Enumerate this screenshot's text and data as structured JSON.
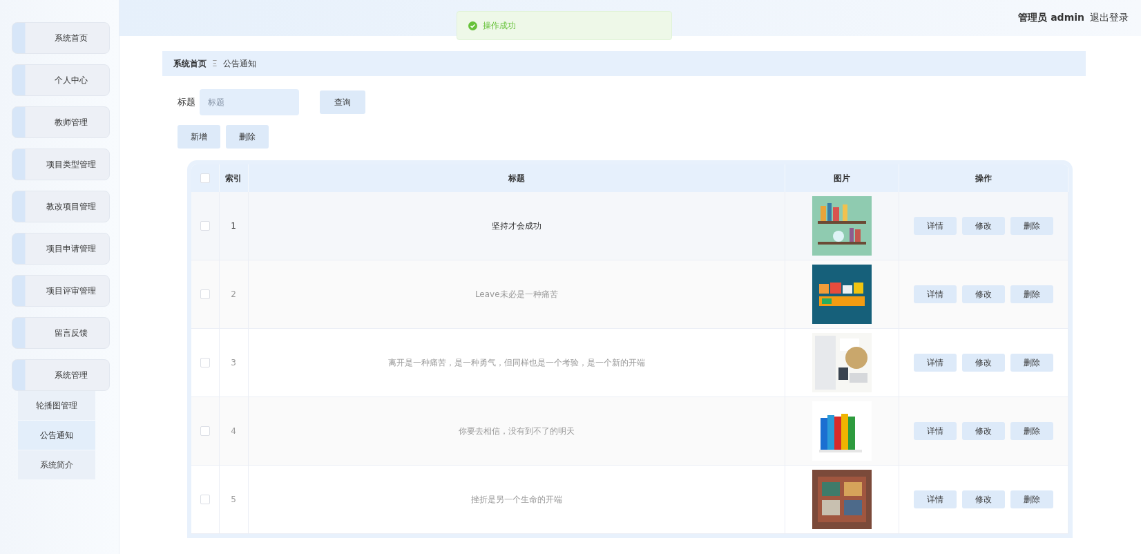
{
  "sidebar": {
    "items": [
      {
        "label": "系统首页",
        "expanded": false
      },
      {
        "label": "个人中心",
        "expanded": false
      },
      {
        "label": "教师管理",
        "expanded": false
      },
      {
        "label": "项目类型管理",
        "expanded": false
      },
      {
        "label": "教改项目管理",
        "expanded": false
      },
      {
        "label": "项目申请管理",
        "expanded": false
      },
      {
        "label": "项目评审管理",
        "expanded": false
      },
      {
        "label": "留言反馈",
        "expanded": false
      },
      {
        "label": "系统管理",
        "expanded": true,
        "children": [
          {
            "label": "轮播图管理",
            "selected": false
          },
          {
            "label": "公告通知",
            "selected": true
          },
          {
            "label": "系统简介",
            "selected": false
          }
        ]
      }
    ]
  },
  "toast": {
    "message": "操作成功"
  },
  "header": {
    "role": "管理员 admin",
    "logout": "退出登录"
  },
  "breadcrumb": {
    "home": "系统首页",
    "separator": "Ξ",
    "current": "公告通知"
  },
  "search": {
    "label": "标题",
    "placeholder": "标题",
    "button": "查询"
  },
  "actions": [
    "新增",
    "删除"
  ],
  "table": {
    "all_checked": false,
    "columns": [
      "索引",
      "标题",
      "图片",
      "操作"
    ],
    "rows": [
      {
        "index": "1",
        "title": "坚持才会成功",
        "checked": false,
        "highlighted": true,
        "image": {
          "kind": "picture"
        },
        "buttons": [
          "详情",
          "修改",
          "删除"
        ]
      },
      {
        "index": "2",
        "title": "Leave未必是一种痛苦",
        "checked": false,
        "highlighted": false,
        "image": {
          "kind": "picture"
        },
        "buttons": [
          "详情",
          "修改",
          "删除"
        ]
      },
      {
        "index": "3",
        "title": "离开是一种痛苦，是一种勇气，但同样也是一个考验，是一个新的开端",
        "checked": false,
        "highlighted": false,
        "image": {
          "kind": "picture"
        },
        "buttons": [
          "详情",
          "修改",
          "删除"
        ]
      },
      {
        "index": "4",
        "title": "你要去相信，没有到不了的明天",
        "checked": false,
        "highlighted": false,
        "image": {
          "kind": "picture"
        },
        "buttons": [
          "详情",
          "修改",
          "删除"
        ]
      },
      {
        "index": "5",
        "title": "挫折是另一个生命的开端",
        "checked": false,
        "highlighted": false,
        "image": {
          "kind": "picture"
        },
        "buttons": [
          "详情",
          "修改",
          "删除"
        ]
      }
    ]
  }
}
